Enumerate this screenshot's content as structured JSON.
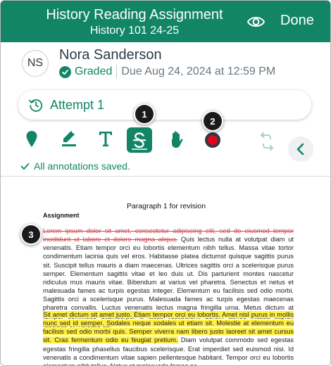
{
  "header": {
    "title": "History Reading Assignment",
    "subtitle": "History 101 24-25",
    "eye_icon": "eye-icon",
    "done_label": "Done",
    "color": "#128567"
  },
  "student": {
    "initials": "NS",
    "name": "Nora Sanderson",
    "status": "Graded",
    "due": "Due Aug 24, 2024 at 12:59 PM"
  },
  "attempt": {
    "icon": "history-icon",
    "label": "Attempt 1"
  },
  "toolbar": {
    "tools": [
      "point-annotation-icon",
      "highlight-pen-icon",
      "text-tool-icon",
      "strikeout-tool-icon",
      "hand-pan-icon",
      "color-picker-icon",
      "undo-redo-icon",
      "collapse-chevron-icon"
    ],
    "active_tool": "strikeout-tool-icon",
    "selected_color": "#e0061f",
    "accent": "#128567"
  },
  "callouts": [
    "1",
    "2",
    "3"
  ],
  "saved_status": "All annotations saved.",
  "document": {
    "heading": "Paragraph 1 for revision",
    "subheading": "Assignment",
    "p1_strike": "Lorem ipsum dolor sit amet, consectetur adipiscing elit, sed do eiusmod tempor incididunt ut labore et dolore magna aliqua.",
    "p1_rest": " Quis lectus nulla at volutpat diam ut venenatis. Etiam tempor orci eu lobortis elementum nibh tellus. Massa vitae tortor condimentum lacinia quis vel eros. Habitasse platea dictumst quisque sagittis purus sit. Suscipit tellus mauris a diam maecenas. Ultrices sagittis orci a scelerisque purus semper. Elementum sagittis vitae et leo duis ut. Dis parturient montes nascetur ridiculus mus mauris vitae. Bibendum at varius vel pharetra. Senectus et netus et malesuada fames ac turpis egestas integer. Elementum eu facilisis sed odio morbi. Sagittis orci a scelerisque purus. Malesuada fames ac turpis egestas maecenas pharetra convallis. Luctus venenatis lectus magna fringilla urna. Metus dictum at tempor commodo ullamcorper a lacus vestibulum. Lorem donec massa sapien faucibus et molestie ac.",
    "p2_highlight": "Sit amet dictum sit amet justo. Etiam tempor orci eu lobortis. Amet nisl purus in mollis nunc sed id semper. Sodales neque sodales ut etiam sit. Molestie at elementum eu facilisis sed odio morbi quis. Semper viverra nam libero justo laoreet sit amet cursus sit. Cras fermentum odio eu feugiat pretium.",
    "p2_rest": " Diam volutpat commodo sed egestas egestas fringilla phasellus faucibus scelerisque. Erat imperdiet sed euismod nisi. Id venenatis a condimentum vitae sapien pellentesque habitant. Tempor orci eu lobortis elementum nibh tellus. Netus et malesuada fames ac."
  }
}
